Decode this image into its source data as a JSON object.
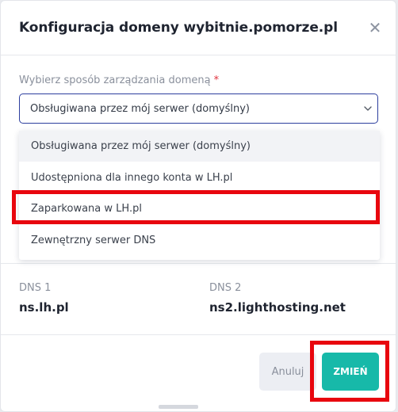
{
  "dialog": {
    "title": "Konfiguracja domeny wybitnie.pomorze.pl",
    "close_icon": "close-icon"
  },
  "domain_management": {
    "label": "Wybierz sposób zarządzania domeną",
    "required_marker": "*",
    "selected_value": "Obsługiwana przez mój serwer (domyślny)",
    "dropdown_icon": "chevron-down-icon",
    "options": [
      "Obsługiwana przez mój serwer (domyślny)",
      "Udostępniona dla innego konta w LH.pl",
      "Zaparkowana w LH.pl",
      "Zewnętrzny serwer DNS"
    ],
    "hovered_option": "Obsługiwana przez mój serwer (domyślny)",
    "annotated_option": "Zaparkowana w LH.pl"
  },
  "dns": [
    {
      "label": "DNS 1",
      "value": "ns.lh.pl"
    },
    {
      "label": "DNS 2",
      "value": "ns2.lighthosting.net"
    }
  ],
  "footer": {
    "cancel_label": "Anuluj",
    "submit_label": "ZMIEŃ"
  },
  "colors": {
    "accent": "#17b9a9",
    "required": "#e0313d",
    "select_border": "#2c3e9e",
    "annotation": "#e8060e"
  }
}
